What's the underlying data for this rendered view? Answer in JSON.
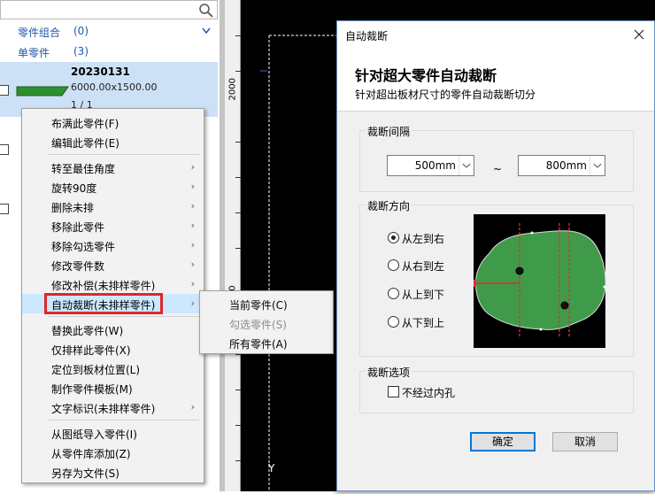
{
  "left_panel": {
    "group_row": {
      "label": "零件组合",
      "count": "(0)"
    },
    "single_row": {
      "label": "单零件",
      "count": "(3)"
    },
    "part": {
      "name": "20230131",
      "size": "6000.00x1500.00",
      "qty": "1 / 1"
    }
  },
  "ruler": {
    "label_1": "2000",
    "label_2": "0"
  },
  "canvas": {
    "axis_label": "Y"
  },
  "context_menu": {
    "items": [
      {
        "label": "布满此零件(F)",
        "submenu": false
      },
      {
        "label": "编辑此零件(E)",
        "submenu": false
      },
      {
        "label": "转至最佳角度",
        "submenu": true
      },
      {
        "label": "旋转90度",
        "submenu": true
      },
      {
        "label": "删除未排",
        "submenu": true
      },
      {
        "label": "移除此零件",
        "submenu": true
      },
      {
        "label": "移除勾选零件",
        "submenu": true
      },
      {
        "label": "修改零件数",
        "submenu": true
      },
      {
        "label": "修改补偿(未排样零件)",
        "submenu": true
      },
      {
        "label": "自动裁断(未排样零件)",
        "submenu": true
      },
      {
        "label": "替换此零件(W)",
        "submenu": false
      },
      {
        "label": "仅排样此零件(X)",
        "submenu": false
      },
      {
        "label": "定位到板材位置(L)",
        "submenu": false
      },
      {
        "label": "制作零件模板(M)",
        "submenu": false
      },
      {
        "label": "文字标识(未排样零件)",
        "submenu": true
      },
      {
        "label": "从图纸导入零件(I)",
        "submenu": false
      },
      {
        "label": "从零件库添加(Z)",
        "submenu": false
      },
      {
        "label": "另存为文件(S)",
        "submenu": false
      }
    ],
    "arrow": "›"
  },
  "submenu": {
    "items": [
      {
        "label": "当前零件(C)",
        "disabled": false
      },
      {
        "label": "勾选零件(S)",
        "disabled": true
      },
      {
        "label": "所有零件(A)",
        "disabled": false
      }
    ]
  },
  "dialog": {
    "title": "自动裁断",
    "heading": "针对超大零件自动裁断",
    "subheading": "针对超出板材尺寸的零件自动裁断切分",
    "interval": {
      "title": "裁断间隔",
      "min_value": "500mm",
      "separator": "~",
      "max_value": "800mm"
    },
    "direction": {
      "title": "裁断方向",
      "options": [
        {
          "label": "从左到右",
          "selected": true
        },
        {
          "label": "从右到左",
          "selected": false
        },
        {
          "label": "从上到下",
          "selected": false
        },
        {
          "label": "从下到上",
          "selected": false
        }
      ]
    },
    "options": {
      "title": "裁断选项",
      "no_inner_hole_label": "不经过内孔",
      "no_inner_hole_checked": false
    },
    "ok_label": "确定",
    "cancel_label": "取消"
  },
  "colors": {
    "selection": "#cce1f6",
    "menu_hover": "#cce8ff",
    "highlight_red": "#e0262c",
    "part_green": "#2f8f2f",
    "link_blue": "#1e5aa8",
    "primary_border": "#0078d7"
  }
}
